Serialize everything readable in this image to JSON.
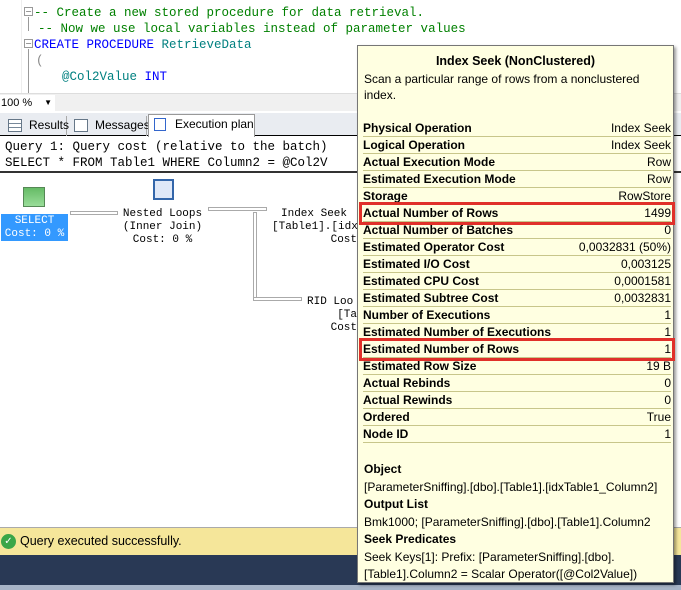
{
  "editor": {
    "lines": [
      "-- Create a new stored procedure for data retrieval.",
      "-- Now we use local variables instead of parameter values",
      "CREATE PROCEDURE",
      "RetrieveData",
      "(",
      "@Col2Value",
      "INT",
      ")"
    ]
  },
  "zoom": {
    "value": "100 %"
  },
  "tabs": [
    {
      "label": "Results",
      "icon": "grid-icon"
    },
    {
      "label": "Messages",
      "icon": "messages-icon"
    },
    {
      "label": "Execution plan",
      "icon": "execution-plan-icon",
      "active": true
    }
  ],
  "query": {
    "line1": "Query 1: Query cost (relative to the batch)",
    "line2": "SELECT * FROM Table1 WHERE Column2 = @Col2V"
  },
  "plan": {
    "select": {
      "name": "SELECT",
      "cost": "Cost: 0 %"
    },
    "nested_loops": {
      "name": "Nested Loops",
      "sub": "(Inner Join)",
      "cost": "Cost: 0 %"
    },
    "index_seek": {
      "name": "Index Seek",
      "sub": "[Table1].[idx",
      "cost": "Cost"
    },
    "rid_lookup": {
      "name": "RID Loo",
      "sub": "[Ta",
      "cost": "Cost"
    }
  },
  "tooltip": {
    "title": "Index Seek (NonClustered)",
    "description": "Scan a particular range of rows from a nonclustered index.",
    "rows": [
      {
        "k": "Physical Operation",
        "v": "Index Seek"
      },
      {
        "k": "Logical Operation",
        "v": "Index Seek"
      },
      {
        "k": "Actual Execution Mode",
        "v": "Row"
      },
      {
        "k": "Estimated Execution Mode",
        "v": "Row"
      },
      {
        "k": "Storage",
        "v": "RowStore"
      },
      {
        "k": "Actual Number of Rows",
        "v": "1499",
        "highlight": true
      },
      {
        "k": "Actual Number of Batches",
        "v": "0"
      },
      {
        "k": "Estimated Operator Cost",
        "v": "0,0032831 (50%)"
      },
      {
        "k": "Estimated I/O Cost",
        "v": "0,003125"
      },
      {
        "k": "Estimated CPU Cost",
        "v": "0,0001581"
      },
      {
        "k": "Estimated Subtree Cost",
        "v": "0,0032831"
      },
      {
        "k": "Number of Executions",
        "v": "1"
      },
      {
        "k": "Estimated Number of Executions",
        "v": "1"
      },
      {
        "k": "Estimated Number of Rows",
        "v": "1",
        "highlight": true
      },
      {
        "k": "Estimated Row Size",
        "v": "19 B"
      },
      {
        "k": "Actual Rebinds",
        "v": "0"
      },
      {
        "k": "Actual Rewinds",
        "v": "0"
      },
      {
        "k": "Ordered",
        "v": "True"
      },
      {
        "k": "Node ID",
        "v": "1"
      }
    ],
    "object_label": "Object",
    "object_value": "[ParameterSniffing].[dbo].[Table1].[idxTable1_Column2]",
    "output_label": "Output List",
    "output_value": "Bmk1000; [ParameterSniffing].[dbo].[Table1].Column2",
    "seek_label": "Seek Predicates",
    "seek_line1": "Seek Keys[1]: Prefix: [ParameterSniffing].[dbo].",
    "seek_line2": "[Table1].Column2 = Scalar Operator([@Col2Value])",
    "highlight_color": "#e0302a"
  },
  "status": {
    "text": "Query executed successfully.",
    "color": "#f5e69a"
  }
}
